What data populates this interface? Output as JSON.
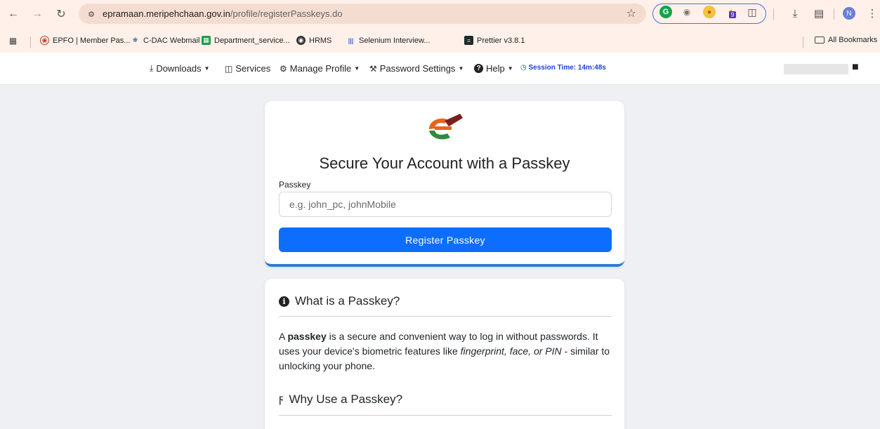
{
  "browser": {
    "url_host": "epramaan.meripehchaan.gov.in",
    "url_path": "/profile/registerPasskeys.do",
    "extension_badge_count": "9",
    "profile_initial": "N",
    "bookmarks": [
      {
        "label": "EPFO | Member Pas...",
        "icon": "epfo-icon"
      },
      {
        "label": "C-DAC Webmail",
        "icon": "cdac-icon"
      },
      {
        "label": "Department_service...",
        "icon": "sheets-icon"
      },
      {
        "label": "HRMS",
        "icon": "globe-icon"
      },
      {
        "label": "Selenium Interview...",
        "icon": "chart-icon"
      },
      {
        "label": "Prettier v3.8.1",
        "icon": "prettier-icon"
      }
    ],
    "all_bookmarks": "All Bookmarks"
  },
  "header": {
    "menu": [
      {
        "label": "Downloads",
        "icon": "download-icon"
      },
      {
        "label": "Services",
        "icon": "file-icon"
      },
      {
        "label": "Manage Profile",
        "icon": "gear-icon"
      },
      {
        "label": "Password Settings",
        "icon": "wrench-icon"
      },
      {
        "label": "Help",
        "icon": "question-icon"
      }
    ],
    "session_label": "Session Time:",
    "session_value": "14m:48s"
  },
  "passkey_card": {
    "title": "Secure Your Account with a Passkey",
    "field_label": "Passkey",
    "input_placeholder": "e.g. john_pc, johnMobile",
    "input_value": "",
    "button_label": "Register Passkey"
  },
  "info_card": {
    "what_heading": "What is a Passkey?",
    "para_a": "A ",
    "para_bold": "passkey",
    "para_b": " is a secure and convenient way to log in without passwords. It uses your device's biometric features like ",
    "para_italic": "fingerprint, face, or PIN",
    "para_c": " - similar to unlocking your phone.",
    "why_heading": "Why Use a Passkey?"
  },
  "colors": {
    "primary_button": "#0d6efd",
    "card_accent": "#2e7bd4",
    "session_text": "#1f3fd6"
  }
}
